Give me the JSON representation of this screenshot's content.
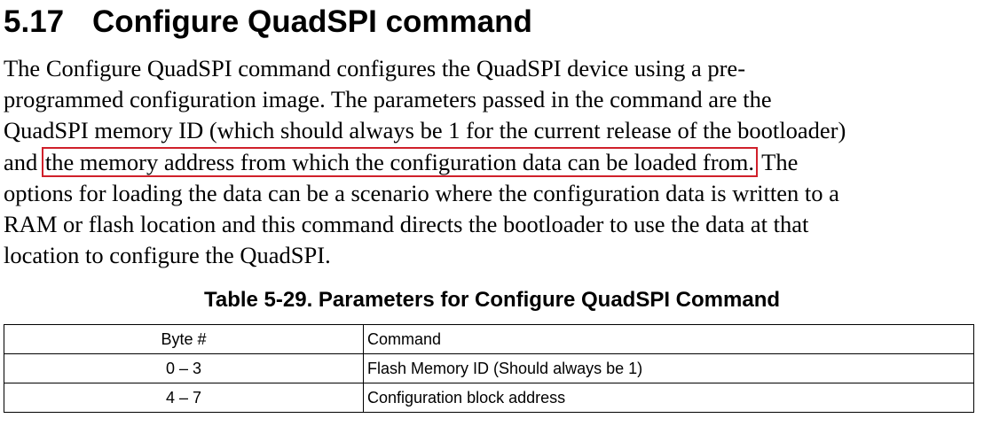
{
  "section": {
    "number": "5.17",
    "title": "Configure QuadSPI command"
  },
  "paragraph": {
    "line1": "The Configure QuadSPI command configures the QuadSPI device using a pre-",
    "line2": "programmed configuration image. The parameters passed in the command are the",
    "line3": "QuadSPI memory ID (which should always be 1 for the current release of the bootloader)",
    "line4_pre": "and ",
    "line4_highlight": "the memory address from which the configuration data can be loaded from.",
    "line4_post": " The",
    "line5": "options for loading the data can be a scenario where the configuration data is written to a",
    "line6": "RAM or flash location and this command directs the bootloader to use the data at that",
    "line7": "location to configure the QuadSPI."
  },
  "table": {
    "caption": "Table 5-29.  Parameters for Configure QuadSPI Command",
    "header": {
      "byte": "Byte #",
      "command": "Command"
    },
    "rows": [
      {
        "byte": "0 – 3",
        "command": "Flash Memory ID (Should always be 1)"
      },
      {
        "byte": "4 – 7",
        "command": "Configuration block address"
      }
    ]
  },
  "colors": {
    "highlight_border": "#d0202a",
    "text": "#000000"
  }
}
